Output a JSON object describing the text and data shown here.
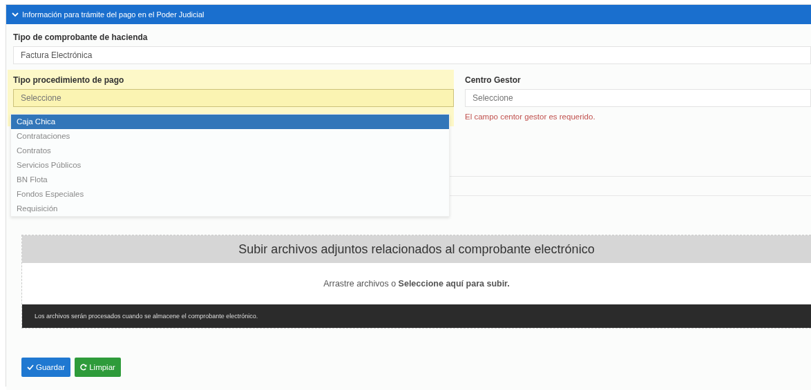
{
  "panel": {
    "title": "Información para trámite del pago en el Poder Judicial",
    "expanded": true
  },
  "voucher_type": {
    "label": "Tipo de comprobante de hacienda",
    "value": "Factura Electrónica"
  },
  "payment_procedure": {
    "label": "Tipo procedimiento de pago",
    "placeholder": "Seleccione",
    "highlighted": true,
    "options": [
      {
        "label": "Caja Chica",
        "selected": true
      },
      {
        "label": "Contrataciones",
        "selected": false
      },
      {
        "label": "Contratos",
        "selected": false
      },
      {
        "label": "Servicios Públicos",
        "selected": false
      },
      {
        "label": "BN Flota",
        "selected": false
      },
      {
        "label": "Fondos Especiales",
        "selected": false
      },
      {
        "label": "Requisición",
        "selected": false
      }
    ]
  },
  "management_center": {
    "label": "Centro Gestor",
    "placeholder": "Seleccione",
    "error": "El campo centor gestor es requerido."
  },
  "upload": {
    "title": "Subir archivos adjuntos relacionados al comprobante electrónico",
    "hint": "Arrastre archivos o **Seleccione aquí para subir.**",
    "note": "Los archivos serán procesados cuando se almacene el comprobante electrónico."
  },
  "buttons": [
    {
      "label": "Guardar",
      "kind": "save"
    },
    {
      "label": "Limpiar",
      "kind": "reset"
    }
  ]
}
